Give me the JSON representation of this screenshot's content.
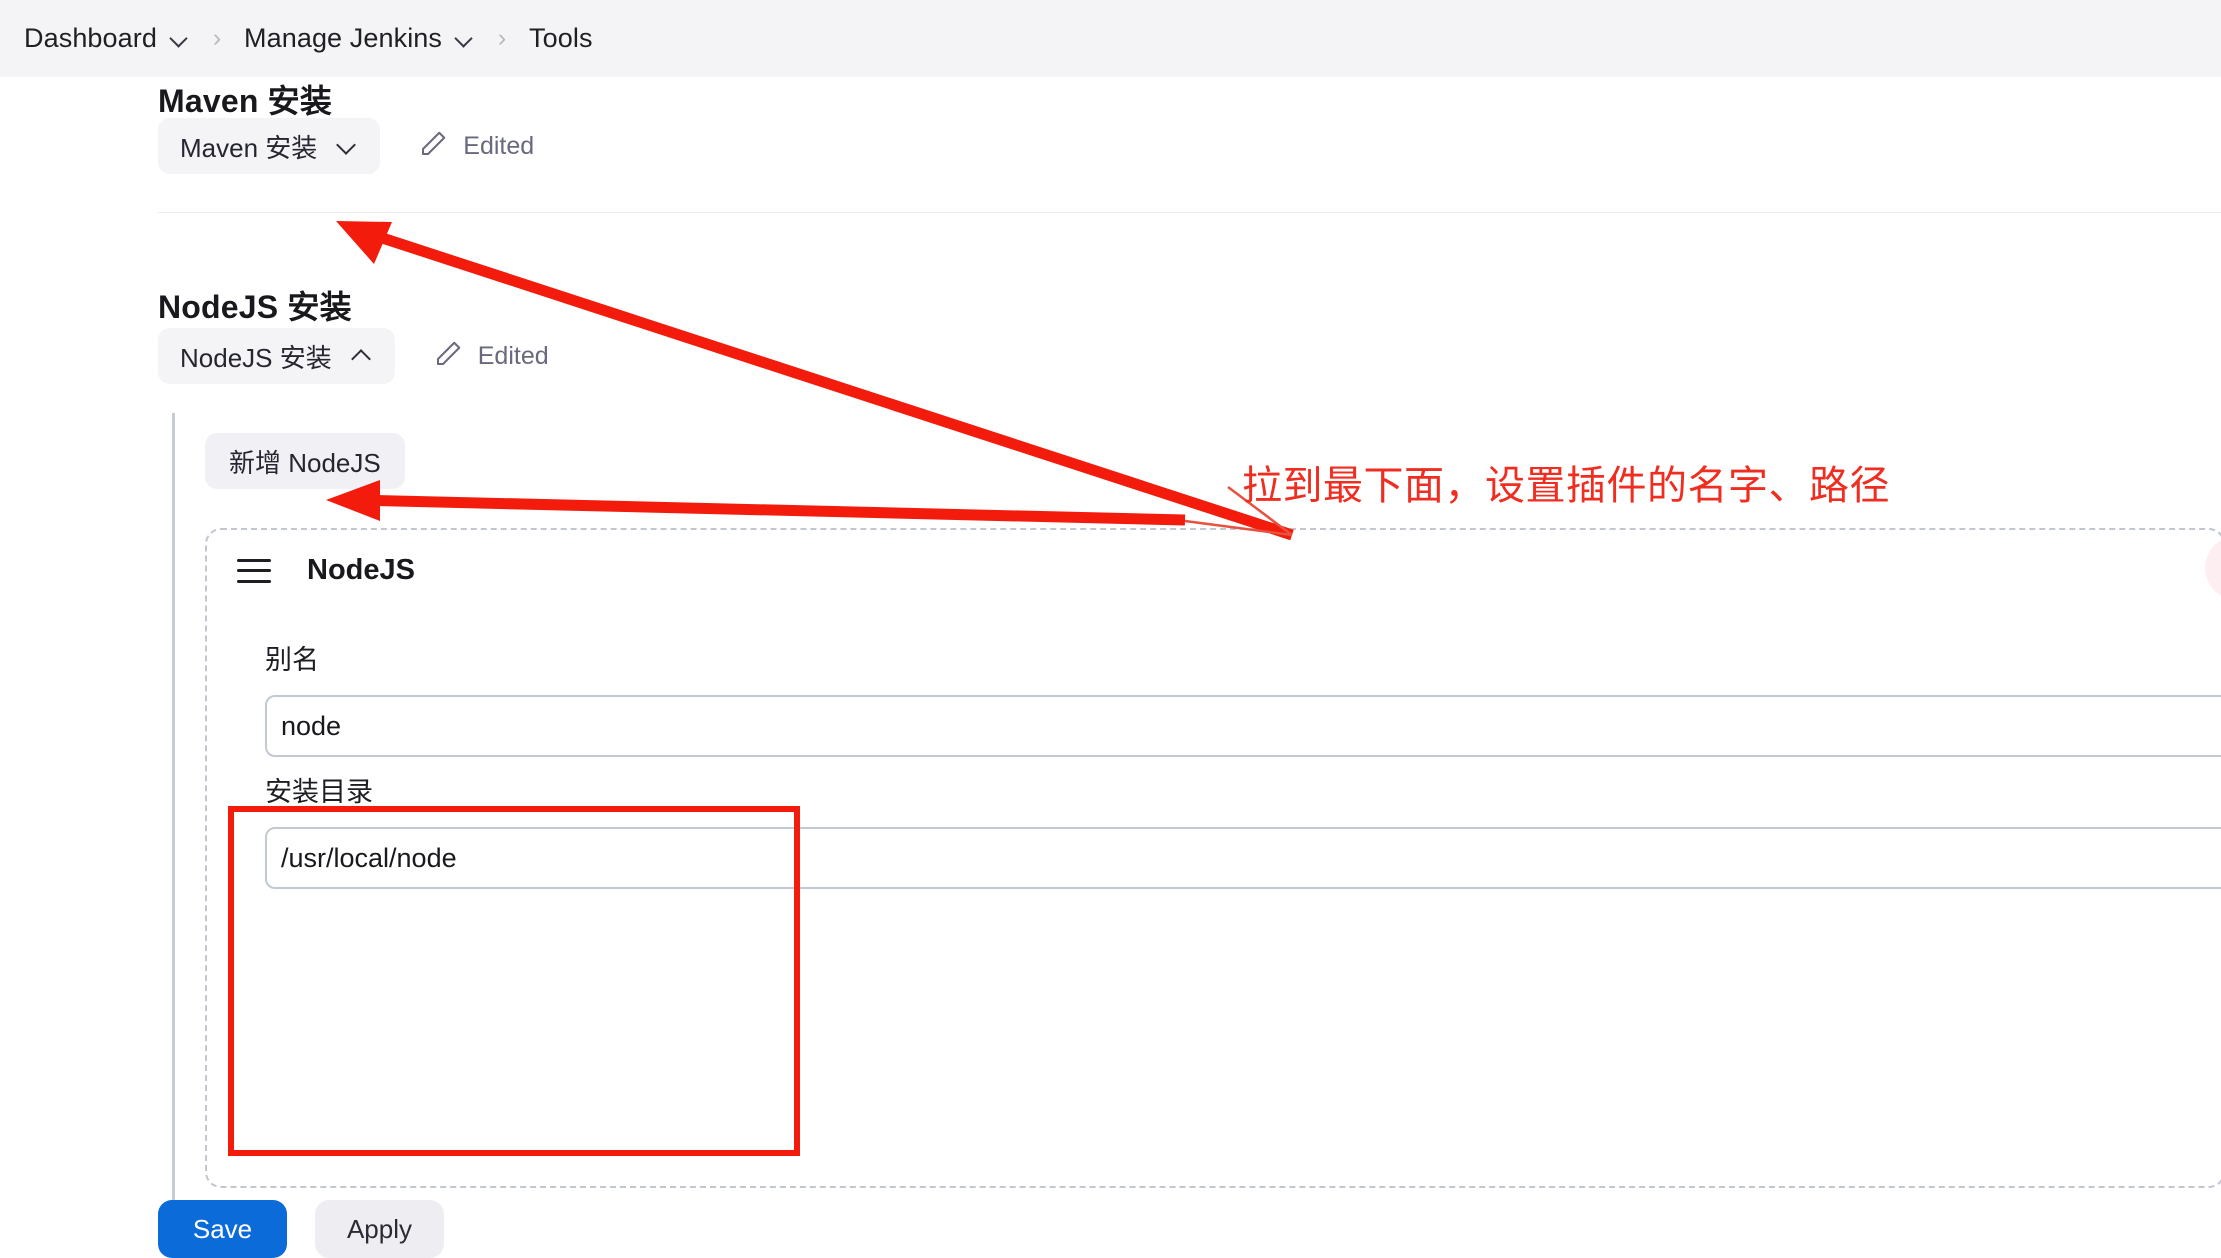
{
  "breadcrumb": {
    "separator": "›",
    "items": [
      {
        "label": "Dashboard",
        "has_caret": true
      },
      {
        "label": "Manage Jenkins",
        "has_caret": true
      },
      {
        "label": "Tools",
        "has_caret": false
      }
    ]
  },
  "sections": {
    "maven": {
      "title": "Maven 安装",
      "toggle_label": "Maven 安装",
      "toggle_state": "collapsed",
      "edited_label": "Edited",
      "edited_icon": "pencil-icon"
    },
    "nodejs": {
      "title": "NodeJS 安装",
      "toggle_label": "NodeJS 安装",
      "toggle_state": "expanded",
      "edited_label": "Edited",
      "edited_icon": "pencil-icon",
      "add_button_label": "新增 NodeJS",
      "card": {
        "title": "NodeJS",
        "drag_icon": "hamburger-drag-icon",
        "delete_icon": "close-x-icon",
        "fields": [
          {
            "label": "别名",
            "value": "node",
            "placeholder": ""
          },
          {
            "label": "安装目录",
            "value": "/usr/local/node",
            "placeholder": ""
          }
        ]
      }
    }
  },
  "actions": {
    "save_label": "Save",
    "apply_label": "Apply"
  },
  "annotations": {
    "note_text": "拉到最下面，设置插件的名字、路径",
    "note_color": "#ef2d20",
    "highlight_color": "#f21b0c"
  },
  "colors": {
    "breadcrumb_bg": "#f4f4f7",
    "pill_bg": "#f4f4f7",
    "primary_button": "#0b6bd8",
    "secondary_button": "#eeeef2",
    "delete_accent": "#d8173a",
    "text_primary": "#19191d",
    "text_muted": "#69697d"
  }
}
